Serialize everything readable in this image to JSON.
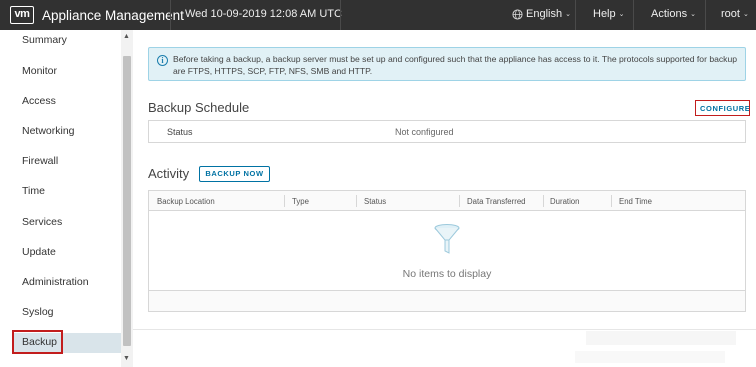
{
  "header": {
    "logo": "vm",
    "title": "Appliance Management",
    "datetime": "Wed 10-09-2019 12:08 AM UTC",
    "language": "English",
    "help": "Help",
    "actions": "Actions",
    "user": "root",
    "caret": "⌄"
  },
  "sidebar": {
    "items": [
      "Summary",
      "Monitor",
      "Access",
      "Networking",
      "Firewall",
      "Time",
      "Services",
      "Update",
      "Administration",
      "Syslog"
    ],
    "active": "Backup"
  },
  "info": {
    "icon": "i",
    "text": "Before taking a backup, a backup server must be set up and configured such that the appliance has access to it. The protocols supported for backup are FTPS, HTTPS, SCP, FTP, NFS, SMB and HTTP."
  },
  "backup_schedule": {
    "title": "Backup Schedule",
    "configure_label": "CONFIGURE",
    "status_label": "Status",
    "status_value": "Not configured"
  },
  "activity": {
    "title": "Activity",
    "backup_now_label": "BACKUP NOW",
    "columns": [
      "Backup Location",
      "Type",
      "Status",
      "Data Transferred",
      "Duration",
      "End Time"
    ],
    "empty_text": "No items to display"
  }
}
